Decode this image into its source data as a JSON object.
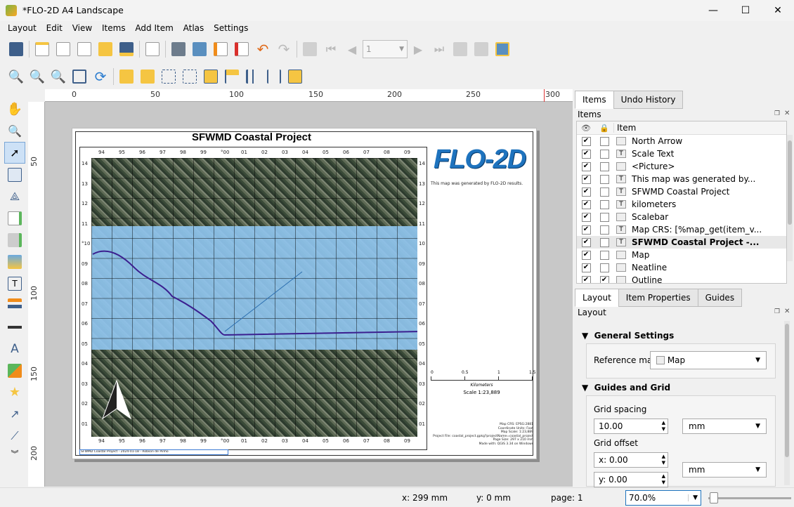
{
  "window": {
    "title": "*FLO-2D A4 Landscape",
    "controls": {
      "minimize": "—",
      "maximize": "☐",
      "close": "✕"
    }
  },
  "menus": [
    "Layout",
    "Edit",
    "View",
    "Items",
    "Add Item",
    "Atlas",
    "Settings"
  ],
  "toolbar": {
    "atlas_page": "1"
  },
  "ruler": {
    "top": [
      "0",
      "50",
      "100",
      "150",
      "200",
      "250",
      "300"
    ],
    "left": [
      "50",
      "100",
      "150",
      "200"
    ]
  },
  "layout_page": {
    "title": "SFWMD Coastal Project",
    "logo": "FLO-2D",
    "generated_text": "This map was generated by FLO-2D results.",
    "scalebar": {
      "ticks": [
        "0",
        "0.5",
        "1",
        "1.5"
      ],
      "unit": "Kilometers",
      "scale_text": "Scale 1:23,889"
    },
    "map_info": [
      "Map CRS: EPSG:2881",
      "Coordinate Units: Foot",
      "Map Scale: 1:23,889",
      "Project File:   coastal_project.gpkg?projectName=coastal_project",
      "Page Size: 297 x 210 mm",
      "Made with: QGIS 3.34 on Windows"
    ],
    "footer": "SFWMD Coastal Project - 2024-01-18 - Robson de Pinho",
    "grid_top": [
      "94",
      "95",
      "96",
      "97",
      "98",
      "99",
      "°00",
      "01",
      "02",
      "03",
      "04",
      "05",
      "06",
      "07",
      "08",
      "09"
    ],
    "grid_left": [
      "14",
      "13",
      "12",
      "11",
      "°10",
      "09",
      "08",
      "07",
      "06",
      "05",
      "04",
      "03",
      "02",
      "01"
    ],
    "grid_right": [
      "14",
      "13",
      "12",
      "11",
      "10",
      "09",
      "08",
      "07",
      "06",
      "05",
      "04",
      "03",
      "02",
      "01"
    ]
  },
  "panel": {
    "tabs": [
      "Items",
      "Undo History"
    ],
    "items_title": "Items",
    "item_header": "Item",
    "items": [
      {
        "name": "North Arrow",
        "visible": true,
        "locked": false,
        "icon": "picture-icon"
      },
      {
        "name": "Scale Text",
        "visible": true,
        "locked": false,
        "icon": "text-icon"
      },
      {
        "name": "<Picture>",
        "visible": true,
        "locked": false,
        "icon": "picture-icon"
      },
      {
        "name": "This map was generated by...",
        "visible": true,
        "locked": false,
        "icon": "text-icon"
      },
      {
        "name": "SFWMD Coastal Project",
        "visible": true,
        "locked": false,
        "icon": "text-icon"
      },
      {
        "name": "kilometers",
        "visible": true,
        "locked": false,
        "icon": "text-icon"
      },
      {
        "name": "Scalebar",
        "visible": true,
        "locked": false,
        "icon": "scalebar-icon"
      },
      {
        "name": "Map CRS: [%map_get(item_v...",
        "visible": true,
        "locked": false,
        "icon": "text-icon"
      },
      {
        "name": "SFWMD Coastal Project -...",
        "visible": true,
        "locked": false,
        "icon": "text-icon",
        "selected": true
      },
      {
        "name": "Map",
        "visible": true,
        "locked": false,
        "icon": "map-icon"
      },
      {
        "name": "Neatline",
        "visible": true,
        "locked": false,
        "icon": "shape-icon"
      },
      {
        "name": "Outline",
        "visible": true,
        "locked": true,
        "icon": "shape-icon"
      }
    ],
    "lower_tabs": [
      "Layout",
      "Item Properties",
      "Guides"
    ],
    "layout_title": "Layout",
    "general_settings": "General Settings",
    "reference_map_label": "Reference map",
    "reference_map_value": "Map",
    "guides_grid": "Guides and Grid",
    "grid_spacing_label": "Grid spacing",
    "grid_spacing_value": "10.00",
    "grid_spacing_unit": "mm",
    "grid_offset_label": "Grid offset",
    "offset_x": "x: 0.00",
    "offset_y": "y: 0.00",
    "offset_unit": "mm"
  },
  "status": {
    "x": "x: 299 mm",
    "y": "y: 0 mm",
    "page": "page: 1",
    "zoom": "70.0%"
  },
  "colors": {
    "accent": "#1e73be",
    "flood": "#8fc4ee",
    "selected_row": "#e8e8e8"
  }
}
